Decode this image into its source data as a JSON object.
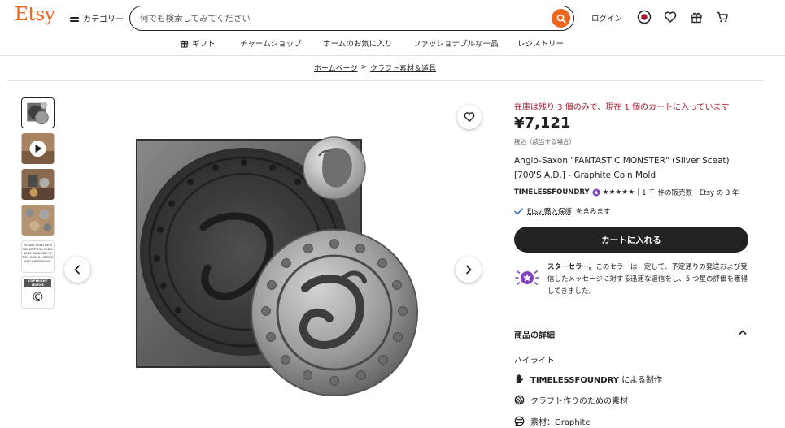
{
  "header": {
    "logo": "Etsy",
    "categories_label": "カテゴリー",
    "search_placeholder": "何でも検索してみてください",
    "login_label": "ログイン"
  },
  "nav": {
    "items": [
      "ギフト",
      "チャームショップ",
      "ホームのお気に入り",
      "ファッショナブルな一品",
      "レジストリー"
    ]
  },
  "breadcrumb": {
    "home": "ホームページ",
    "separator": ">",
    "category": "クラフト素材＆道具"
  },
  "product": {
    "stock_notice": "在庫は残り 3 個のみで、現在 1 個のカートに入っています",
    "price": "¥7,121",
    "tax_note": "税込（該当する場合）",
    "title": "Anglo-Saxon \"FANTASTIC MONSTER\" (Silver Sceat) [700'S A.D.] - Graphite Coin Mold",
    "shop_name": "TIMELESSFOUNDRY",
    "stars": "★★★★★",
    "sales": "1 千 件の販売数",
    "years": "Etsy の 3 年",
    "separator": "|",
    "protection_link": "Etsy 購入保護",
    "protection_suffix": "を含みます",
    "add_to_cart": "カートに入れる",
    "star_seller_title": "スターセラー。",
    "star_seller_desc": "このセラーは一定して、予定通りの発送および受信したメッセージに対する迅速な返信をし、5 つ星の評価を獲得してきました。"
  },
  "thumbnails": {
    "text_thumb_1": "PLEASE READ ITEM DESCRIPTION FOR A BRIEF SUMMARY OF THIS COIN'S HISTORY AND DIMENSIONS.",
    "text_thumb_2_title": "COPYRIGHT NOTICE",
    "text_thumb_2_symbol": "©"
  },
  "details": {
    "heading": "商品の詳細",
    "highlight_heading": "ハイライト",
    "made_by_shop": "TIMELESSFOUNDRY",
    "made_by_suffix": "による制作",
    "craft_supply": "クラフト作りのための素材",
    "material_label": "素材：",
    "material_value": "Graphite"
  },
  "colors": {
    "brand": "#F1641E",
    "stock_red": "#A61A2E",
    "dark": "#222222",
    "star_seller_purple": "#7F3FBF"
  }
}
